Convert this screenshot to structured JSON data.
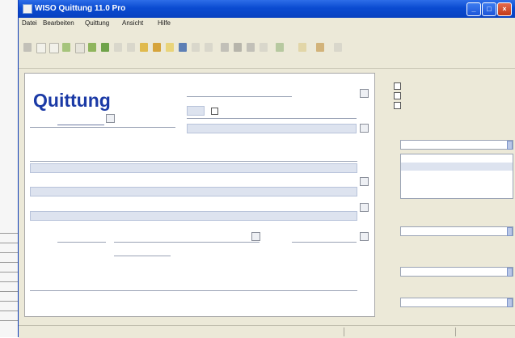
{
  "window": {
    "title": "WISO Quittung 11.0 Pro"
  },
  "menu": {
    "items": [
      "Datei",
      "Bearbeiten",
      "Quittung",
      "Ansicht",
      "Hilfe"
    ]
  },
  "form": {
    "title": "Quittung",
    "fields": {
      "quittung_nr_value": "",
      "betrag_value": "",
      "mwst_value": "",
      "gesamt_value": ""
    }
  },
  "status": {
    "left": "",
    "middle": "",
    "right": ""
  }
}
